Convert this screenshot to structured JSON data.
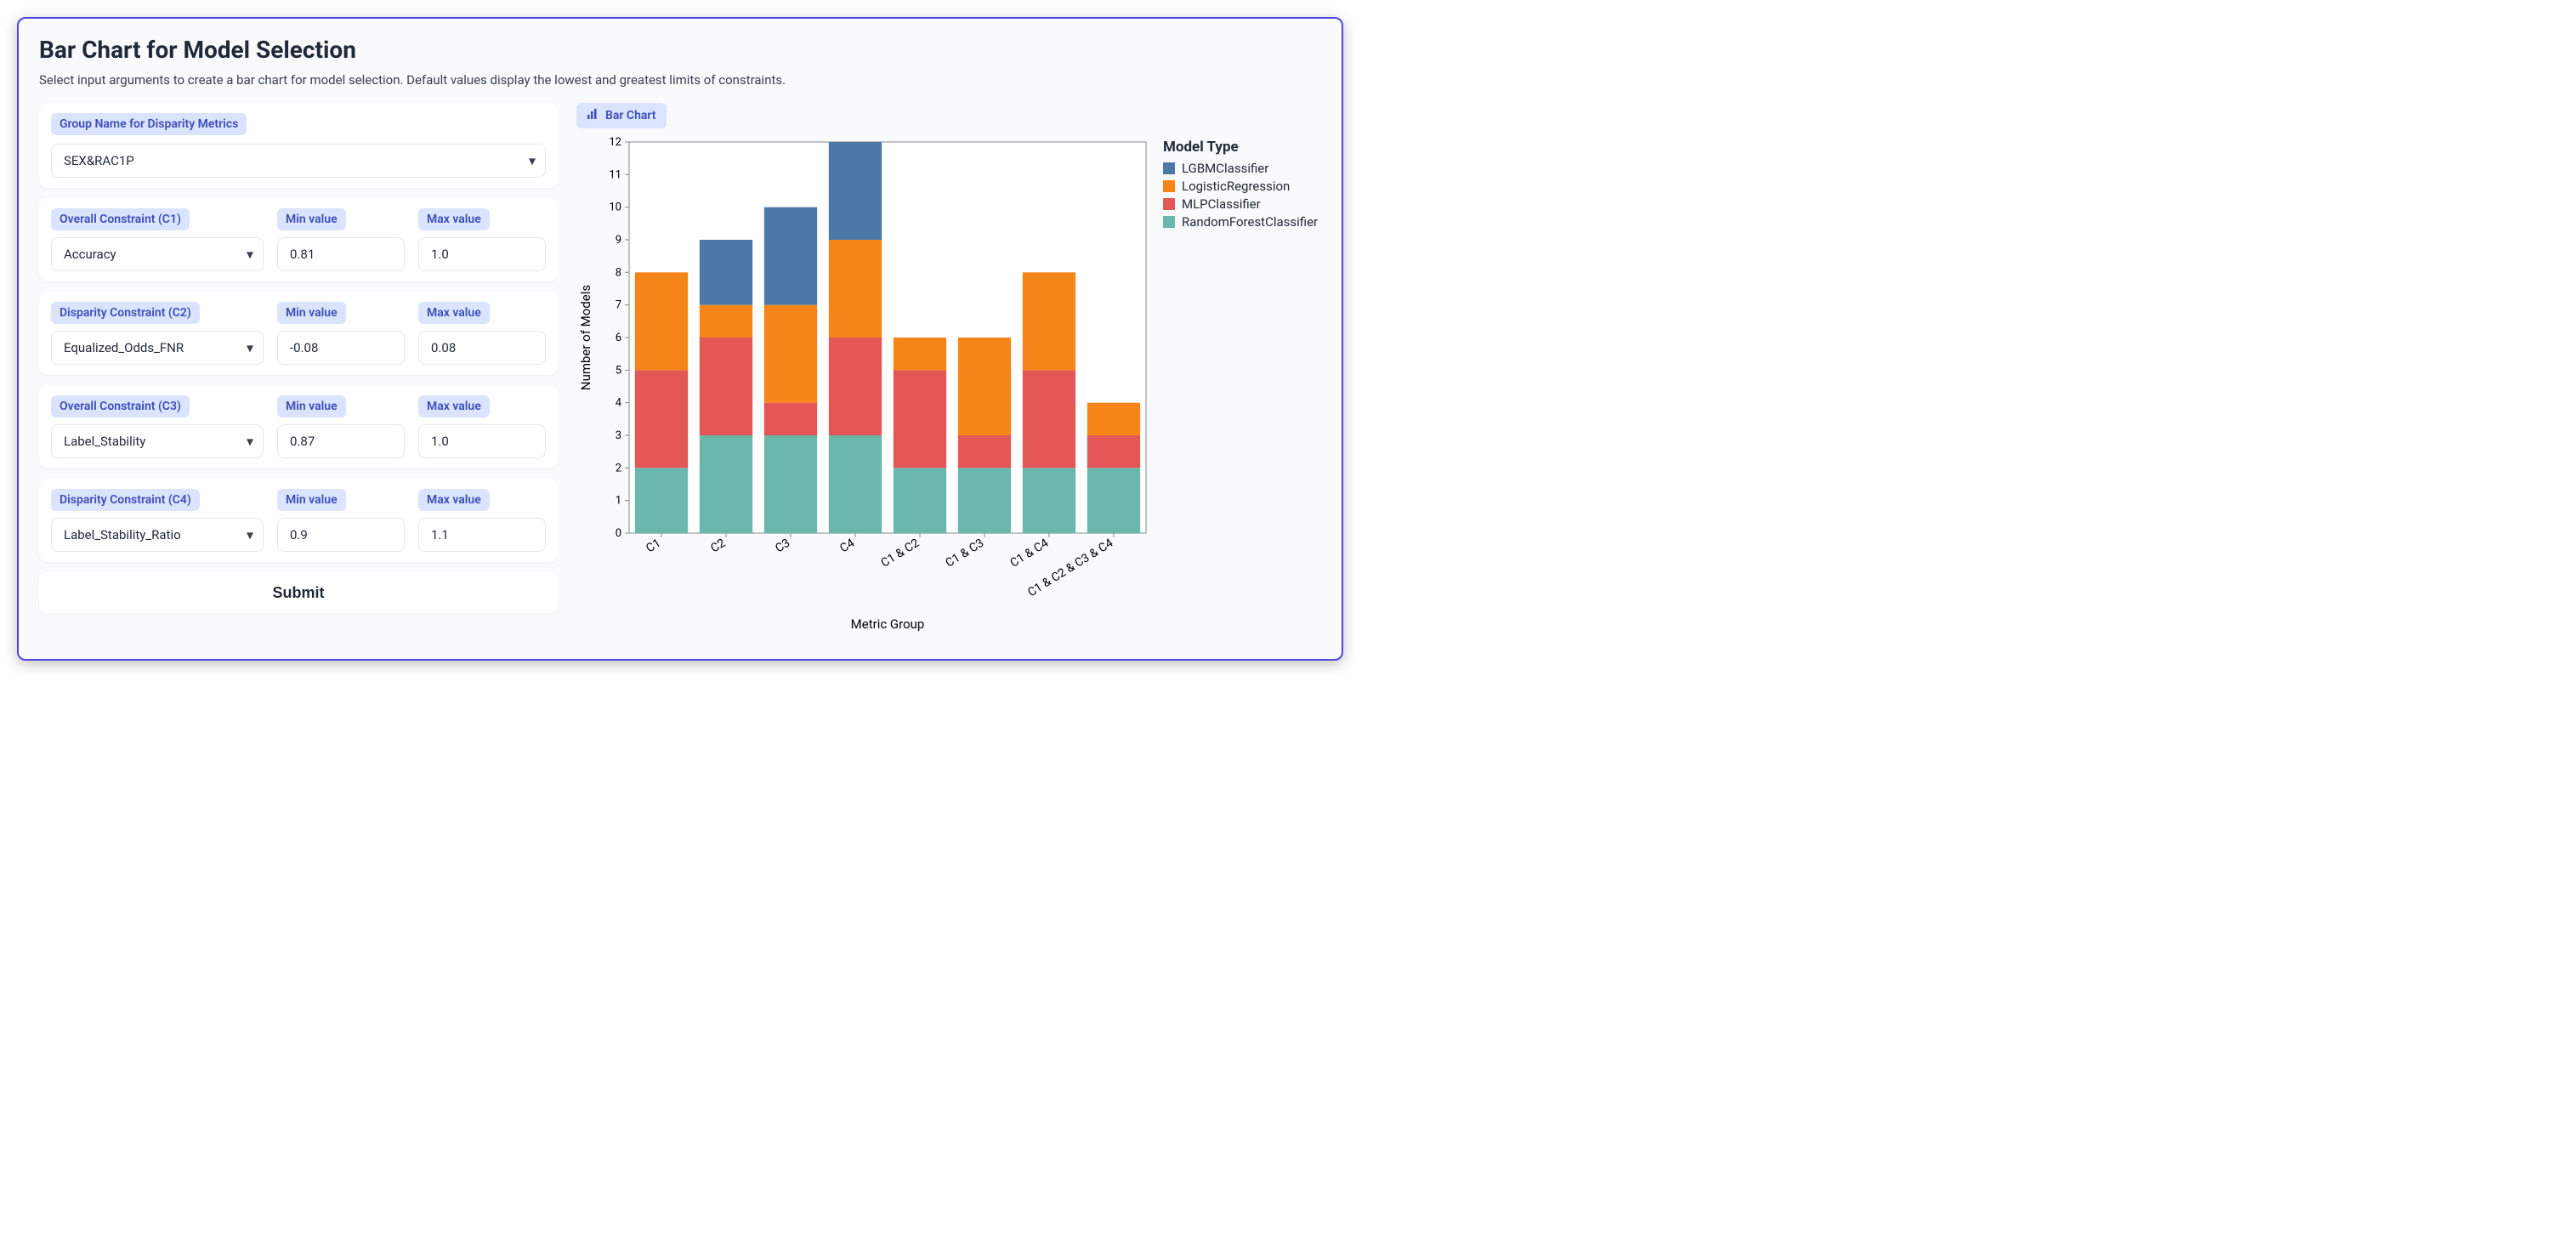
{
  "header": {
    "title": "Bar Chart for Model Selection",
    "subtitle": "Select input arguments to create a bar chart for model selection. Default values display the lowest and greatest limits of constraints."
  },
  "group": {
    "label": "Group Name for Disparity Metrics",
    "value": "SEX&RAC1P"
  },
  "constraints": [
    {
      "label": "Overall Constraint (C1)",
      "metric": "Accuracy",
      "min": "0.81",
      "max": "1.0"
    },
    {
      "label": "Disparity Constraint (C2)",
      "metric": "Equalized_Odds_FNR",
      "min": "-0.08",
      "max": "0.08"
    },
    {
      "label": "Overall Constraint (C3)",
      "metric": "Label_Stability",
      "min": "0.87",
      "max": "1.0"
    },
    {
      "label": "Disparity Constraint (C4)",
      "metric": "Label_Stability_Ratio",
      "min": "0.9",
      "max": "1.1"
    }
  ],
  "labels": {
    "min": "Min value",
    "max": "Max value",
    "submit": "Submit",
    "chart_tab": "Bar Chart"
  },
  "chart_data": {
    "type": "bar",
    "stacked": true,
    "title": "",
    "xlabel": "Metric Group",
    "ylabel": "Number of Models",
    "ylim": [
      0,
      12
    ],
    "yticks": [
      0,
      1,
      2,
      3,
      4,
      5,
      6,
      7,
      8,
      9,
      10,
      11,
      12
    ],
    "categories": [
      "C1",
      "C2",
      "C3",
      "C4",
      "C1 & C2",
      "C1 & C3",
      "C1 & C4",
      "C1 & C2 & C3 & C4"
    ],
    "legend_title": "Model Type",
    "series": [
      {
        "name": "RandomForestClassifier",
        "color": "#6ab8ac",
        "values": [
          2,
          3,
          3,
          3,
          2,
          2,
          2,
          2
        ]
      },
      {
        "name": "MLPClassifier",
        "color": "#e45756",
        "values": [
          3,
          3,
          1,
          3,
          3,
          1,
          3,
          1
        ]
      },
      {
        "name": "LogisticRegression",
        "color": "#f58518",
        "values": [
          3,
          1,
          3,
          3,
          1,
          3,
          3,
          1
        ]
      },
      {
        "name": "LGBMClassifier",
        "color": "#4c78a8",
        "values": [
          0,
          2,
          3,
          3,
          0,
          0,
          0,
          0
        ]
      }
    ],
    "legend_order": [
      "LGBMClassifier",
      "LogisticRegression",
      "MLPClassifier",
      "RandomForestClassifier"
    ]
  }
}
